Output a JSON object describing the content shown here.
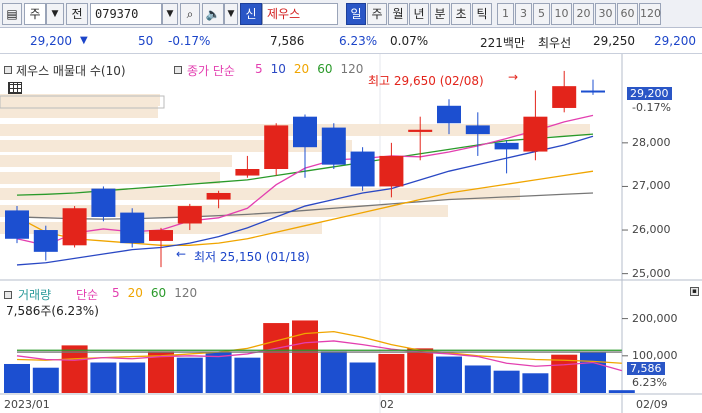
{
  "toolbar": {
    "market": "주",
    "prev_label": "전",
    "code": "079370",
    "credit_label": "신",
    "name": "제우스",
    "period_tabs": [
      "일",
      "주",
      "월",
      "년",
      "분",
      "초",
      "틱"
    ],
    "selected_period": "일",
    "interval_tabs": [
      "1",
      "3",
      "5",
      "10",
      "20",
      "30",
      "60",
      "120"
    ]
  },
  "info": {
    "price": "29,200",
    "change": "50",
    "change_pct": "-0.17%",
    "volume": "7,586",
    "turnover_pct": "6.23%",
    "vol_ratio": "0.07%",
    "amount": "221백만",
    "best_ask_label": "최우선",
    "best_ask": "29,250",
    "best_bid": "29,200"
  },
  "price_panel": {
    "legend_title": "제우스 매물대 수(10)",
    "ma_label": "종가 단순",
    "ma_periods": [
      "5",
      "10",
      "20",
      "60",
      "120"
    ],
    "ma_colors": [
      "#e33fb0",
      "#2a48c4",
      "#f0a500",
      "#2a9a2a",
      "#777777"
    ],
    "high_label": "최고 29,650 (02/08)",
    "low_label": "최저 25,150 (01/18)",
    "current_price": "29,200",
    "current_change": "-0.17%",
    "y_ticks": [
      "28,000",
      "27,000",
      "26,000",
      "25,000"
    ]
  },
  "volume_panel": {
    "legend_title": "거래량",
    "ma_label": "단순",
    "ma_periods": [
      "5",
      "20",
      "60",
      "120"
    ],
    "info": "7,586주(6.23%)",
    "current_volume": "7,586",
    "current_pct": "6.23%",
    "y_ticks": [
      "200,000",
      "100,000"
    ]
  },
  "x_axis": {
    "labels": [
      "2023/01",
      "02"
    ],
    "last_date": "02/09"
  },
  "chart_data": {
    "type": "candlestick",
    "candles": [
      {
        "o": 26450,
        "c": 25800,
        "h": 26550,
        "l": 25700,
        "up": false
      },
      {
        "o": 26000,
        "c": 25500,
        "h": 26100,
        "l": 25300,
        "up": false
      },
      {
        "o": 25650,
        "c": 26500,
        "h": 26550,
        "l": 25600,
        "up": true
      },
      {
        "o": 26950,
        "c": 26300,
        "h": 27000,
        "l": 26200,
        "up": false
      },
      {
        "o": 26400,
        "c": 25700,
        "h": 26500,
        "l": 25600,
        "up": false
      },
      {
        "o": 25750,
        "c": 26000,
        "h": 26050,
        "l": 25150,
        "up": true
      },
      {
        "o": 26150,
        "c": 26550,
        "h": 26600,
        "l": 26000,
        "up": true
      },
      {
        "o": 26700,
        "c": 26850,
        "h": 26900,
        "l": 26500,
        "up": true
      },
      {
        "o": 27250,
        "c": 27400,
        "h": 27700,
        "l": 27200,
        "up": true
      },
      {
        "o": 27400,
        "c": 28400,
        "h": 28450,
        "l": 27250,
        "up": true
      },
      {
        "o": 28600,
        "c": 27900,
        "h": 28650,
        "l": 27200,
        "up": false
      },
      {
        "o": 28350,
        "c": 27500,
        "h": 28450,
        "l": 27400,
        "up": false
      },
      {
        "o": 27800,
        "c": 27000,
        "h": 27900,
        "l": 26900,
        "up": false
      },
      {
        "o": 27000,
        "c": 27700,
        "h": 28000,
        "l": 26750,
        "up": true
      },
      {
        "o": 28250,
        "c": 28300,
        "h": 28600,
        "l": 27600,
        "up": true
      },
      {
        "o": 28850,
        "c": 28450,
        "h": 29000,
        "l": 28200,
        "up": false
      },
      {
        "o": 28400,
        "c": 28200,
        "h": 28700,
        "l": 27700,
        "up": false
      },
      {
        "o": 28000,
        "c": 27850,
        "h": 28050,
        "l": 27300,
        "up": false
      },
      {
        "o": 27800,
        "c": 28600,
        "h": 29200,
        "l": 27600,
        "up": true
      },
      {
        "o": 28800,
        "c": 29300,
        "h": 29650,
        "l": 28700,
        "up": true
      },
      {
        "o": 29200,
        "c": 29200,
        "h": 29450,
        "l": 29100,
        "up": false
      }
    ],
    "volumes": [
      78000,
      68000,
      128000,
      82000,
      82000,
      112000,
      95000,
      110000,
      95000,
      188000,
      195000,
      112000,
      82000,
      105000,
      120000,
      98000,
      74000,
      60000,
      53000,
      103000,
      110000,
      7586
    ],
    "volume_up": [
      false,
      false,
      true,
      false,
      false,
      true,
      false,
      false,
      false,
      true,
      true,
      false,
      false,
      true,
      true,
      false,
      false,
      false,
      false,
      true,
      false,
      false
    ],
    "ylim_price": [
      24900,
      29900
    ],
    "ylim_volume": [
      0,
      250000
    ]
  }
}
